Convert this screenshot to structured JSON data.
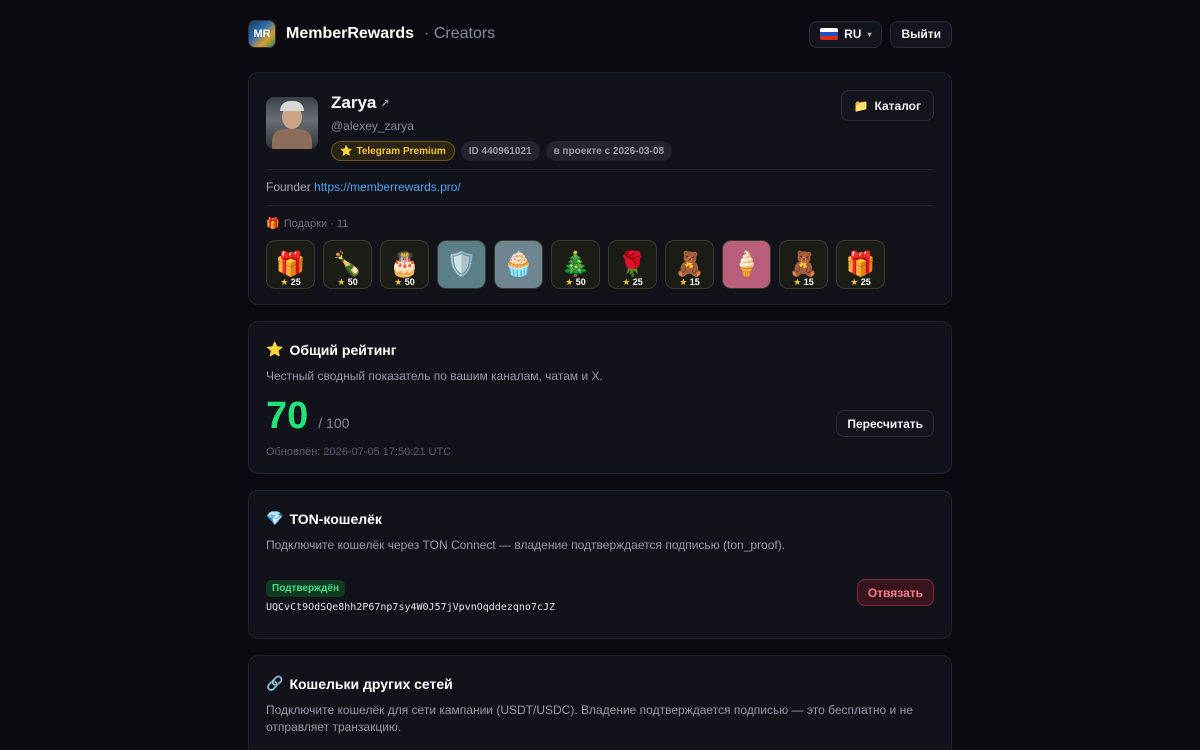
{
  "header": {
    "logo_text": "MR",
    "brand_name": "MemberRewards",
    "brand_sub": "· Creators",
    "lang_label": "RU",
    "logout_label": "Выйти"
  },
  "profile": {
    "name": "Zarya",
    "handle": "@alexey_zarya",
    "badges": {
      "premium": "Telegram Premium",
      "id": "ID 440961021",
      "since": "в проекте с 2026-03-08"
    },
    "catalog_label": "Каталог",
    "bio_prefix": "Founder",
    "bio_link": "https://memberrewards.pro/",
    "gifts_label": "Подарки · 11",
    "gifts": [
      {
        "icon": "🎁",
        "price": "25"
      },
      {
        "icon": "🍾",
        "price": "50"
      },
      {
        "icon": "🎂",
        "price": "50"
      },
      {
        "icon": "🛡️",
        "price": ""
      },
      {
        "icon": "🧁",
        "price": ""
      },
      {
        "icon": "🎄",
        "price": "50"
      },
      {
        "icon": "🌹",
        "price": "25"
      },
      {
        "icon": "🧸",
        "price": "15"
      },
      {
        "icon": "🍦",
        "price": ""
      },
      {
        "icon": "🧸",
        "price": "15"
      },
      {
        "icon": "🎁",
        "price": "25"
      }
    ]
  },
  "rating": {
    "icon": "⭐",
    "title": "Общий рейтинг",
    "description": "Честный сводный показатель по вашим каналам, чатам и X.",
    "score": "70",
    "max": "/ 100",
    "updated": "Обновлён: 2026-07-05 17:50:21 UTC",
    "recalc_label": "Пересчитать"
  },
  "ton_wallet": {
    "icon": "💎",
    "title": "TON-кошелёк",
    "description": "Подключите кошелёк через TON Connect — владение подтверждается подписью (ton_proof).",
    "status": "Подтверждён",
    "address": "UQCvCt9OdSQe8hh2P67np7sy4W0J57jVpvnOqddezqno7cJZ",
    "unlink_label": "Отвязать"
  },
  "other_wallets": {
    "icon": "🔗",
    "title": "Кошельки других сетей",
    "description": "Подключите кошелёк для сети кампании (USDT/USDC). Владение подтверждается подписью — это бесплатно и не отправляет транзакцию."
  },
  "colors": {
    "accent_green": "#22e27a",
    "link_blue": "#4aa3f5",
    "danger": "#ff7b8e",
    "premium_gold": "#f5c542"
  }
}
